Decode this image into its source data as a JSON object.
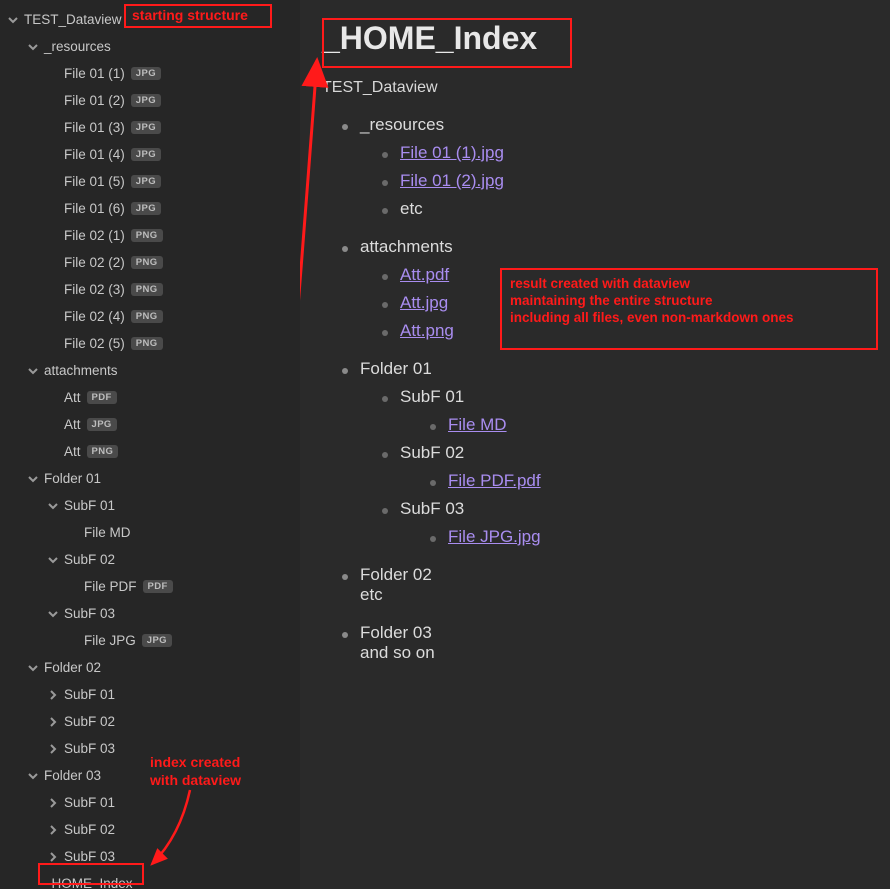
{
  "annotations": {
    "starting_structure": "starting structure",
    "index_created": "index created\nwith dataview",
    "result_text": "result created with dataview\nmaintaining the entire structure\nincluding all files, even non-markdown ones"
  },
  "sidebar": {
    "root": "TEST_Dataview",
    "resources": {
      "label": "_resources",
      "items": [
        {
          "name": "File 01 (1)",
          "ext": "JPG"
        },
        {
          "name": "File 01 (2)",
          "ext": "JPG"
        },
        {
          "name": "File 01 (3)",
          "ext": "JPG"
        },
        {
          "name": "File 01 (4)",
          "ext": "JPG"
        },
        {
          "name": "File 01 (5)",
          "ext": "JPG"
        },
        {
          "name": "File 01 (6)",
          "ext": "JPG"
        },
        {
          "name": "File 02 (1)",
          "ext": "PNG"
        },
        {
          "name": "File 02 (2)",
          "ext": "PNG"
        },
        {
          "name": "File 02 (3)",
          "ext": "PNG"
        },
        {
          "name": "File 02 (4)",
          "ext": "PNG"
        },
        {
          "name": "File 02 (5)",
          "ext": "PNG"
        }
      ]
    },
    "attachments": {
      "label": "attachments",
      "items": [
        {
          "name": "Att",
          "ext": "PDF"
        },
        {
          "name": "Att",
          "ext": "JPG"
        },
        {
          "name": "Att",
          "ext": "PNG"
        }
      ]
    },
    "folder01": {
      "label": "Folder 01",
      "sub": [
        {
          "label": "SubF 01",
          "open": true,
          "file": {
            "name": "File MD",
            "ext": ""
          }
        },
        {
          "label": "SubF 02",
          "open": true,
          "file": {
            "name": "File PDF",
            "ext": "PDF"
          }
        },
        {
          "label": "SubF 03",
          "open": true,
          "file": {
            "name": "File JPG",
            "ext": "JPG"
          }
        }
      ]
    },
    "folder02": {
      "label": "Folder 02",
      "sub": [
        "SubF 01",
        "SubF 02",
        "SubF 03"
      ]
    },
    "folder03": {
      "label": "Folder 03",
      "sub": [
        "SubF 01",
        "SubF 02",
        "SubF 03"
      ]
    },
    "home_index": "_HOME_Index"
  },
  "note": {
    "title": "_HOME_Index",
    "breadcrumb": "TEST_Dataview",
    "resources": {
      "label": "_resources",
      "items": [
        "File 01 (1).jpg",
        "File 01 (2).jpg"
      ],
      "etc": "etc"
    },
    "attachments": {
      "label": "attachments",
      "items": [
        "Att.pdf",
        "Att.jpg",
        "Att.png"
      ]
    },
    "folder01": {
      "label": "Folder 01",
      "sub": [
        {
          "label": "SubF 01",
          "file": "File MD"
        },
        {
          "label": "SubF 02",
          "file": "File PDF.pdf"
        },
        {
          "label": "SubF 03",
          "file": "File JPG.jpg"
        }
      ]
    },
    "folder02": {
      "label": "Folder 02",
      "etc": "etc"
    },
    "folder03": {
      "label": "Folder 03",
      "etc": "and so on"
    }
  }
}
